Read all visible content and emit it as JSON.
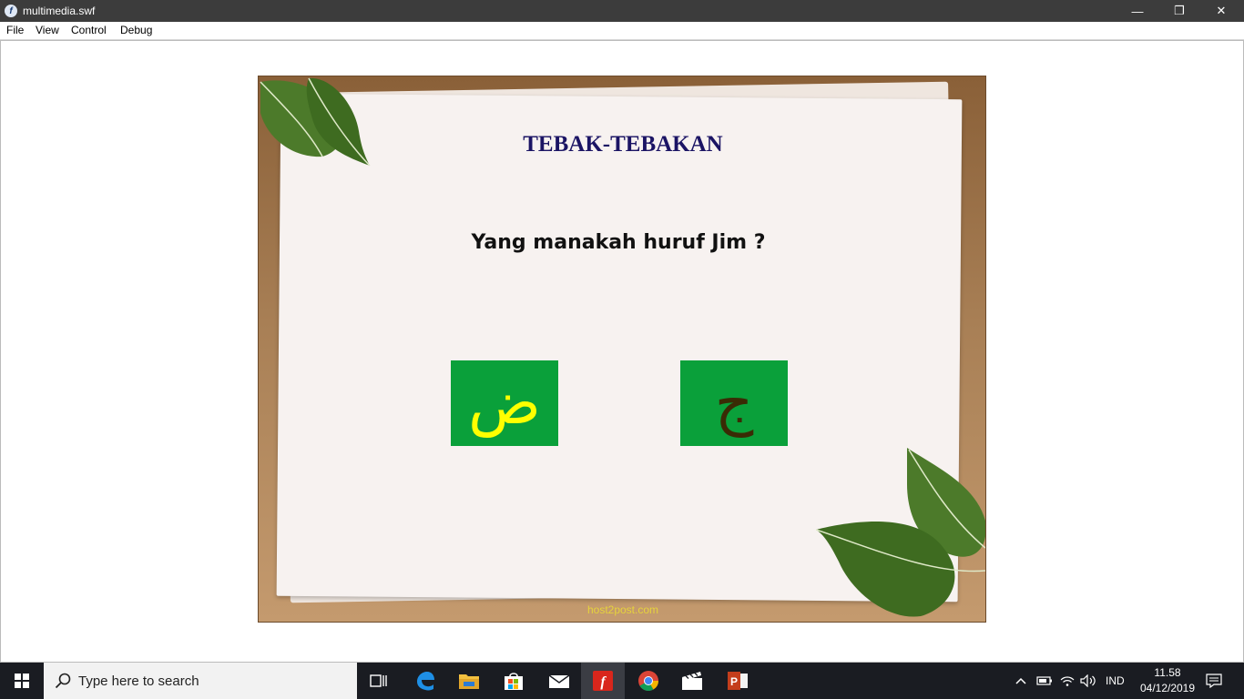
{
  "window": {
    "title": "multimedia.swf",
    "minimize_glyph": "—",
    "maximize_glyph": "❐",
    "close_glyph": "✕"
  },
  "menu": {
    "items": [
      "File",
      "View",
      "Control",
      "Debug"
    ]
  },
  "game": {
    "title": "TEBAK-TEBAKAN",
    "question": "Yang manakah huruf Jim ?",
    "choices": [
      {
        "letter": "ض",
        "color": "#ffff00"
      },
      {
        "letter": "ج",
        "color": "#3a2b05"
      }
    ],
    "watermark": "host2post.com",
    "colors": {
      "choice_bg": "#0aa03a",
      "title": "#1b1464",
      "board": "#a87f55",
      "paper": "#f7f2f0"
    }
  },
  "taskbar": {
    "search_placeholder": "Type here to search",
    "language": "IND",
    "time": "11.58",
    "date": "04/12/2019",
    "pinned_apps": [
      "task-view-icon",
      "edge-icon",
      "file-explorer-icon",
      "store-icon",
      "mail-icon",
      "flash-player-icon",
      "chrome-icon",
      "movie-maker-icon",
      "powerpoint-icon"
    ]
  }
}
